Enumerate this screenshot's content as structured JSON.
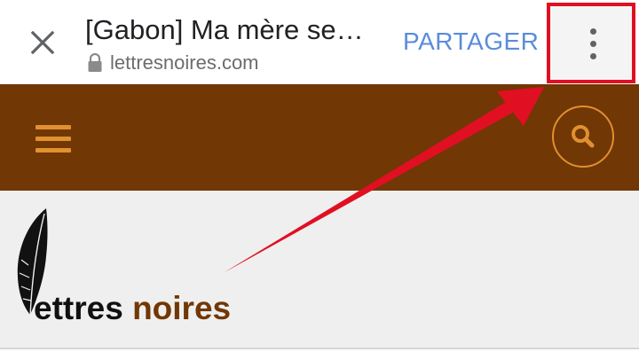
{
  "tab_bar": {
    "title": "[Gabon] Ma mère se…",
    "url": "lettresnoires.com",
    "share_label": "PARTAGER"
  },
  "site": {
    "logo_part1": "ettres ",
    "logo_part2": "noires"
  },
  "icons": {
    "close": "close-icon",
    "lock": "lock-icon",
    "menu": "more-vertical-icon",
    "hamburger": "hamburger-icon",
    "search": "search-icon",
    "logo": "feather-icon",
    "annotation": "red-arrow"
  },
  "colors": {
    "header_bg": "#713705",
    "accent_orange": "#e0902f",
    "share_blue": "#5b8cd9",
    "highlight_red": "#e10f22"
  }
}
